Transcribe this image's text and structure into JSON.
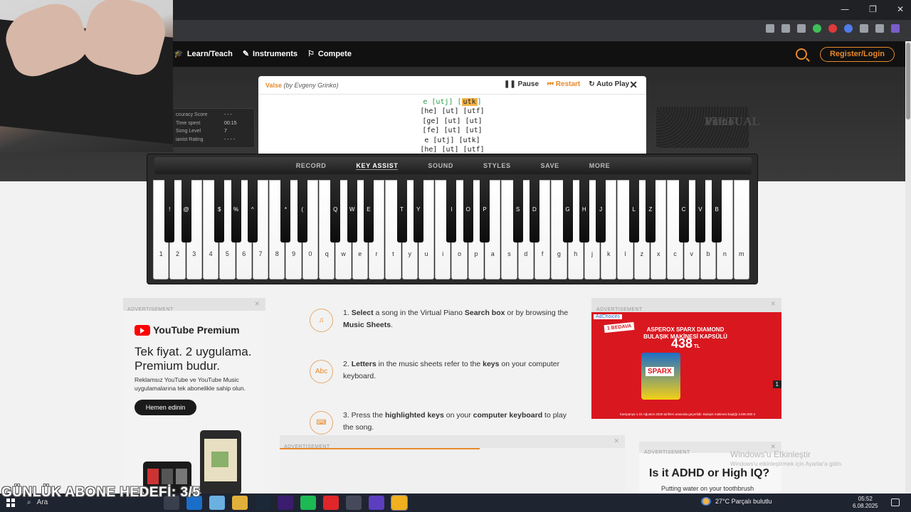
{
  "browser": {
    "window_controls": [
      "—",
      "❐",
      "✕"
    ],
    "icon_colors": [
      "#9aa0a6",
      "#9aa0a6",
      "#9aa0a6",
      "#3fbf5a",
      "#e03a3a",
      "#4f7de8",
      "#9aa0a6",
      "#9aa0a6",
      "#7b5cc9"
    ]
  },
  "nav": {
    "partial_label": "s",
    "links": [
      "Learn/Teach",
      "Instruments",
      "Compete"
    ],
    "register_label": "Register/Login"
  },
  "stats": {
    "rows": [
      {
        "label": "ccuracy Score",
        "value": "- - -"
      },
      {
        "label": "Time spent",
        "value": "00:15"
      },
      {
        "label": "Song Level",
        "value": "7"
      },
      {
        "label": "ianist Rating",
        "value": "- - - -"
      }
    ]
  },
  "logo_text": [
    "VIRTUAL",
    "Piano"
  ],
  "sheet": {
    "title": "Valse",
    "author": "(by Evgeny Grinko)",
    "controls": {
      "pause": "Pause",
      "restart": "Restart",
      "autoplay": "Auto Play",
      "close": "✕"
    },
    "first_line": {
      "pre": "e [utj] [",
      "current": "utk",
      "post": "]"
    },
    "lines": [
      "[he] [ut] [utf]",
      "[ge] [ut] [ut]",
      "[fe] [ut] [ut]",
      "e [utj] [utk]",
      "[he] [ut] [utf]"
    ]
  },
  "piano": {
    "menu": [
      "RECORD",
      "KEY ASSIST",
      "SOUND",
      "STYLES",
      "SAVE",
      "MORE"
    ],
    "active_menu": "KEY ASSIST",
    "white_keys": [
      "1",
      "2",
      "3",
      "4",
      "5",
      "6",
      "7",
      "8",
      "9",
      "0",
      "q",
      "w",
      "e",
      "r",
      "t",
      "y",
      "u",
      "i",
      "o",
      "p",
      "a",
      "s",
      "d",
      "f",
      "g",
      "h",
      "j",
      "k",
      "l",
      "z",
      "x",
      "c",
      "v",
      "b",
      "n",
      "m"
    ],
    "black_keys": [
      {
        "label": "!",
        "after": 0
      },
      {
        "label": "@",
        "after": 1
      },
      {
        "label": "$",
        "after": 3
      },
      {
        "label": "%",
        "after": 4
      },
      {
        "label": "^",
        "after": 5
      },
      {
        "label": "*",
        "after": 7
      },
      {
        "label": "(",
        "after": 8
      },
      {
        "label": "Q",
        "after": 10
      },
      {
        "label": "W",
        "after": 11
      },
      {
        "label": "E",
        "after": 12
      },
      {
        "label": "T",
        "after": 14
      },
      {
        "label": "Y",
        "after": 15
      },
      {
        "label": "I",
        "after": 17
      },
      {
        "label": "O",
        "after": 18
      },
      {
        "label": "P",
        "after": 19
      },
      {
        "label": "S",
        "after": 21
      },
      {
        "label": "D",
        "after": 22
      },
      {
        "label": "G",
        "after": 24
      },
      {
        "label": "H",
        "after": 25
      },
      {
        "label": "J",
        "after": 26
      },
      {
        "label": "L",
        "after": 28
      },
      {
        "label": "Z",
        "after": 29
      },
      {
        "label": "C",
        "after": 31
      },
      {
        "label": "V",
        "after": 32
      },
      {
        "label": "B",
        "after": 33
      }
    ]
  },
  "ads": {
    "label": "ADVERTISEMENT",
    "close": "✕",
    "youtube": {
      "brand": "YouTube Premium",
      "headline": "Tek fiyat. 2 uygulama. Premium budur.",
      "body": "Reklamsız YouTube ve YouTube Music uygulamalarına tek abonelikle sahip olun.",
      "cta": "Hemen edinin"
    },
    "bim": {
      "adchoices": "AdChoices",
      "badge": "1 BEDAVA",
      "brand": "ASPEROX SPARX DIAMOND BULAŞIK MAKİNESİ KAPSÜLÜ",
      "price": "438",
      "currency": "TL",
      "product": "SPARX",
      "page": "1",
      "fine": "Kampanya 1-31 Ağustos 2025 tarihleri arasında geçerlidir. Bulaşık makinesi başlığı 3.000.000 ü"
    },
    "adhd": {
      "headline": "Is it ADHD or High IQ?",
      "body": "Putting water on your toothbrush"
    }
  },
  "steps": [
    {
      "icon": "♫",
      "parts": [
        [
          "1. ",
          false
        ],
        [
          "Select",
          true
        ],
        [
          " a song in the Virtual Piano ",
          false
        ],
        [
          "Search box",
          true
        ],
        [
          " or by browsing the ",
          false
        ],
        [
          "Music Sheets",
          true
        ],
        [
          ".",
          false
        ]
      ]
    },
    {
      "icon": "Abc",
      "parts": [
        [
          "2. ",
          false
        ],
        [
          "Letters",
          true
        ],
        [
          " in the music sheets refer to the ",
          false
        ],
        [
          "keys",
          true
        ],
        [
          " on your computer keyboard.",
          false
        ]
      ]
    },
    {
      "icon": "⌨",
      "parts": [
        [
          "3. Press the ",
          false
        ],
        [
          "highlighted keys",
          true
        ],
        [
          " on your ",
          false
        ],
        [
          "computer keyboard",
          true
        ],
        [
          " to play the song.",
          false
        ]
      ]
    }
  ],
  "windows": {
    "activate_title": "Windows'u Etkinleştir",
    "activate_sub": "Windows'u etkinleştirmek için Ayarlar'a gidin."
  },
  "overlay": "GÜNLÜK ABONE HEDEFİ: 3/5",
  "taskbar": {
    "search": "Ara",
    "app_colors": [
      "#3a3f4d",
      "#1a6ec9",
      "#6ab0e0",
      "#e0b03a",
      "#1b2838",
      "#3a1d6e",
      "#1db954",
      "#e0262a",
      "#444a5a",
      "#5c3ec0",
      "#f0b020"
    ],
    "weather": "27°C  Parçalı bulutlu",
    "time": "05:52",
    "date": "6.08.2025"
  }
}
